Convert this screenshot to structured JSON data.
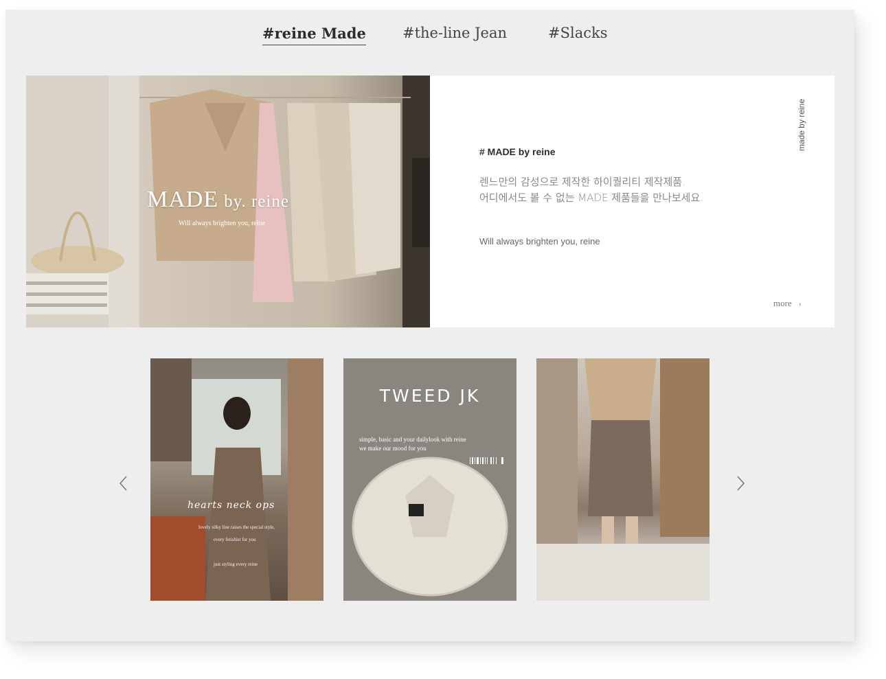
{
  "tabs": [
    {
      "label": "#reine Made",
      "active": true
    },
    {
      "label": "#the-line Jean",
      "active": false
    },
    {
      "label": "#Slacks",
      "active": false
    }
  ],
  "feature": {
    "overlay_title": "MADE",
    "overlay_title_small": "by. reine",
    "overlay_subtitle": "Will always brighten you, reine",
    "hashtag": "# MADE by reine",
    "desc_line1": "렌느만의 감성으로 제작한 하이퀄리티 제작제품.",
    "desc_line2": "어디에서도 볼 수 없는 MADE 제품들을 만나보세요.",
    "tagline": "Will always brighten you, reine",
    "vertical_label": "made by reine",
    "more_label": "more",
    "more_icon": "chevron-right-icon"
  },
  "carousel": {
    "prev_icon": "chevron-left-icon",
    "next_icon": "chevron-right-icon",
    "items": [
      {
        "script": "hearts neck ops",
        "line1": "lovely silky line raises the special style,",
        "line2": "every fetishist for you",
        "line3": "just styling every reine"
      },
      {
        "title": "TWEED JK",
        "sub1": "simple, basic and your dailylook with reine",
        "sub2": "we make our mood for you"
      },
      {}
    ]
  },
  "colors": {
    "background": "#eeeeee",
    "panel": "#ffffff",
    "text_dark": "#2c2c2c",
    "text_muted": "#8a8a8a"
  }
}
